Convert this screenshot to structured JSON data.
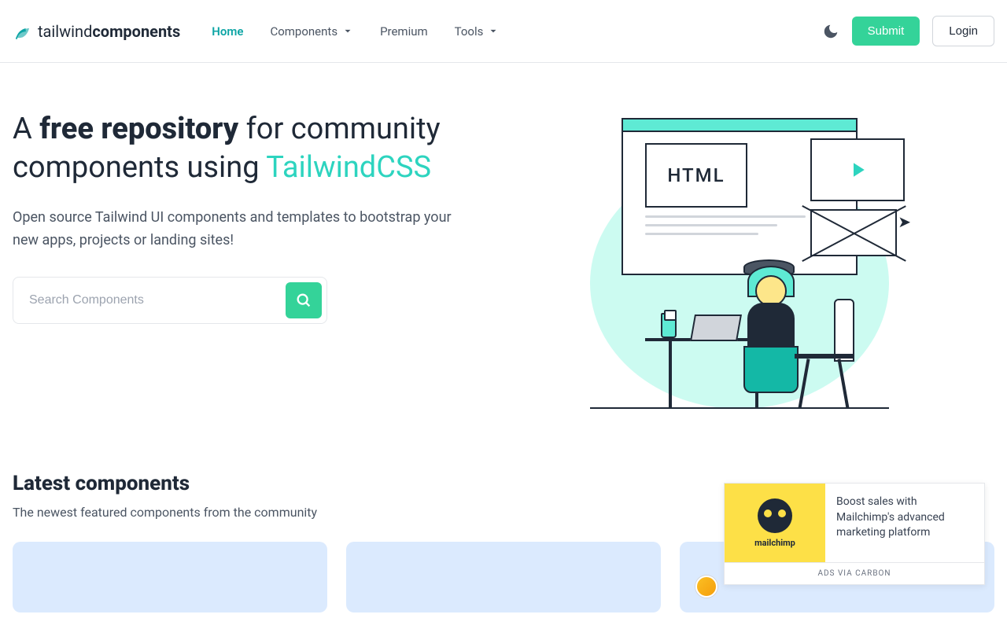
{
  "logo": {
    "light": "tailwind",
    "bold": "components"
  },
  "nav": {
    "home": "Home",
    "components": "Components",
    "premium": "Premium",
    "tools": "Tools"
  },
  "actions": {
    "submit": "Submit",
    "login": "Login"
  },
  "hero": {
    "t1": "A ",
    "t2": "free repository",
    "t3": " for community components using ",
    "t4": "TailwindCSS",
    "sub": "Open source Tailwind UI components and templates to bootstrap your new apps, projects or landing sites!",
    "placeholder": "Search Components",
    "illus_label": "HTML"
  },
  "latest": {
    "title": "Latest components",
    "sub": "The newest featured components from the community"
  },
  "ad": {
    "brand": "mailchimp",
    "text": "Boost sales with Mailchimp's advanced marketing platform",
    "foot": "ADS VIA CARBON"
  }
}
